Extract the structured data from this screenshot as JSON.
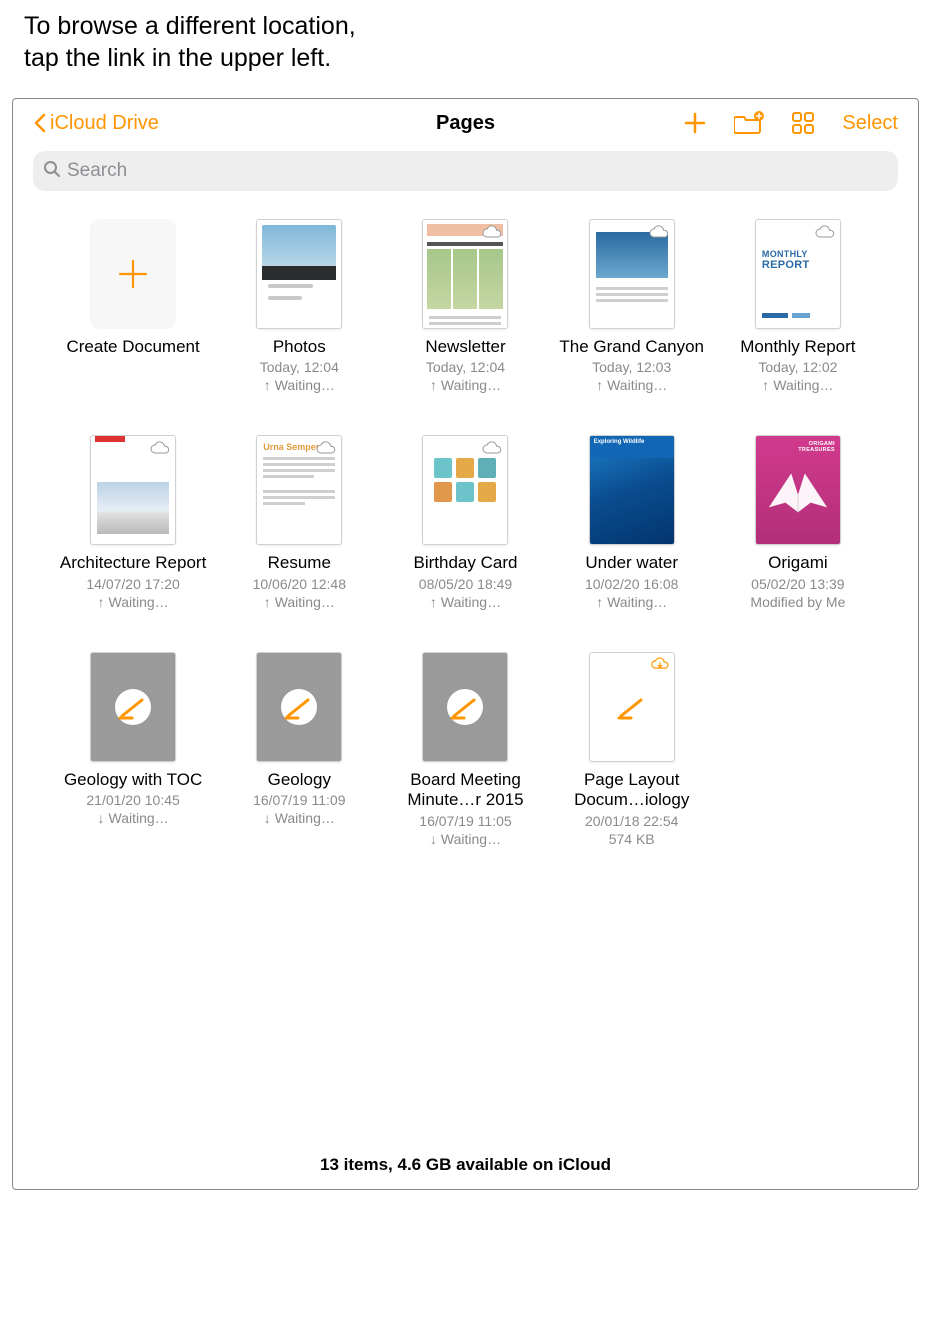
{
  "callout": "To browse a different location, tap the link in the upper left.",
  "toolbar": {
    "back_label": "iCloud Drive",
    "title": "Pages",
    "select_label": "Select"
  },
  "search": {
    "placeholder": "Search"
  },
  "tiles": {
    "create": {
      "name": "Create Document"
    },
    "photos": {
      "name": "Photos",
      "sub": "Today, 12:04",
      "status": "Waiting…",
      "dir": "up"
    },
    "newsletter": {
      "name": "Newsletter",
      "sub": "Today, 12:04",
      "status": "Waiting…",
      "dir": "up"
    },
    "canyon": {
      "name": "The Grand Canyon",
      "sub": "Today, 12:03",
      "status": "Waiting…",
      "dir": "up"
    },
    "monthly": {
      "name": "Monthly Report",
      "sub": "Today, 12:02",
      "status": "Waiting…",
      "dir": "up"
    },
    "arch": {
      "name": "Architecture Report",
      "sub": "14/07/20 17:20",
      "status": "Waiting…",
      "dir": "up"
    },
    "resume": {
      "name": "Resume",
      "sub": "10/06/20 12:48",
      "status": "Waiting…",
      "dir": "up"
    },
    "birthday": {
      "name": "Birthday Card",
      "sub": "08/05/20 18:49",
      "status": "Waiting…",
      "dir": "up"
    },
    "underwater": {
      "name": "Under water",
      "sub": "10/02/20 16:08",
      "status": "Waiting…",
      "dir": "up"
    },
    "origami": {
      "name": "Origami",
      "sub": "05/02/20 13:39",
      "status": "Modified by Me"
    },
    "geotoc": {
      "name": "Geology with TOC",
      "sub": "21/01/20 10:45",
      "status": "Waiting…",
      "dir": "down"
    },
    "geology": {
      "name": "Geology",
      "sub": "16/07/19 11:09",
      "status": "Waiting…",
      "dir": "down"
    },
    "board": {
      "name": "Board Meeting Minute…r 2015",
      "sub": "16/07/19 11:05",
      "status": "Waiting…",
      "dir": "down"
    },
    "layout": {
      "name": "Page Layout Docum…iology",
      "sub": "20/01/18 22:54",
      "status": "574 KB"
    }
  },
  "thumbtext": {
    "monthly1": "MONTHLY",
    "monthly2": "REPORT",
    "resume": "Urna Semper",
    "origami": "ORIGAMI TREASURES",
    "underwater": "Exploring Wildlife"
  },
  "status_bar": "13 items, 4.6 GB available on iCloud"
}
